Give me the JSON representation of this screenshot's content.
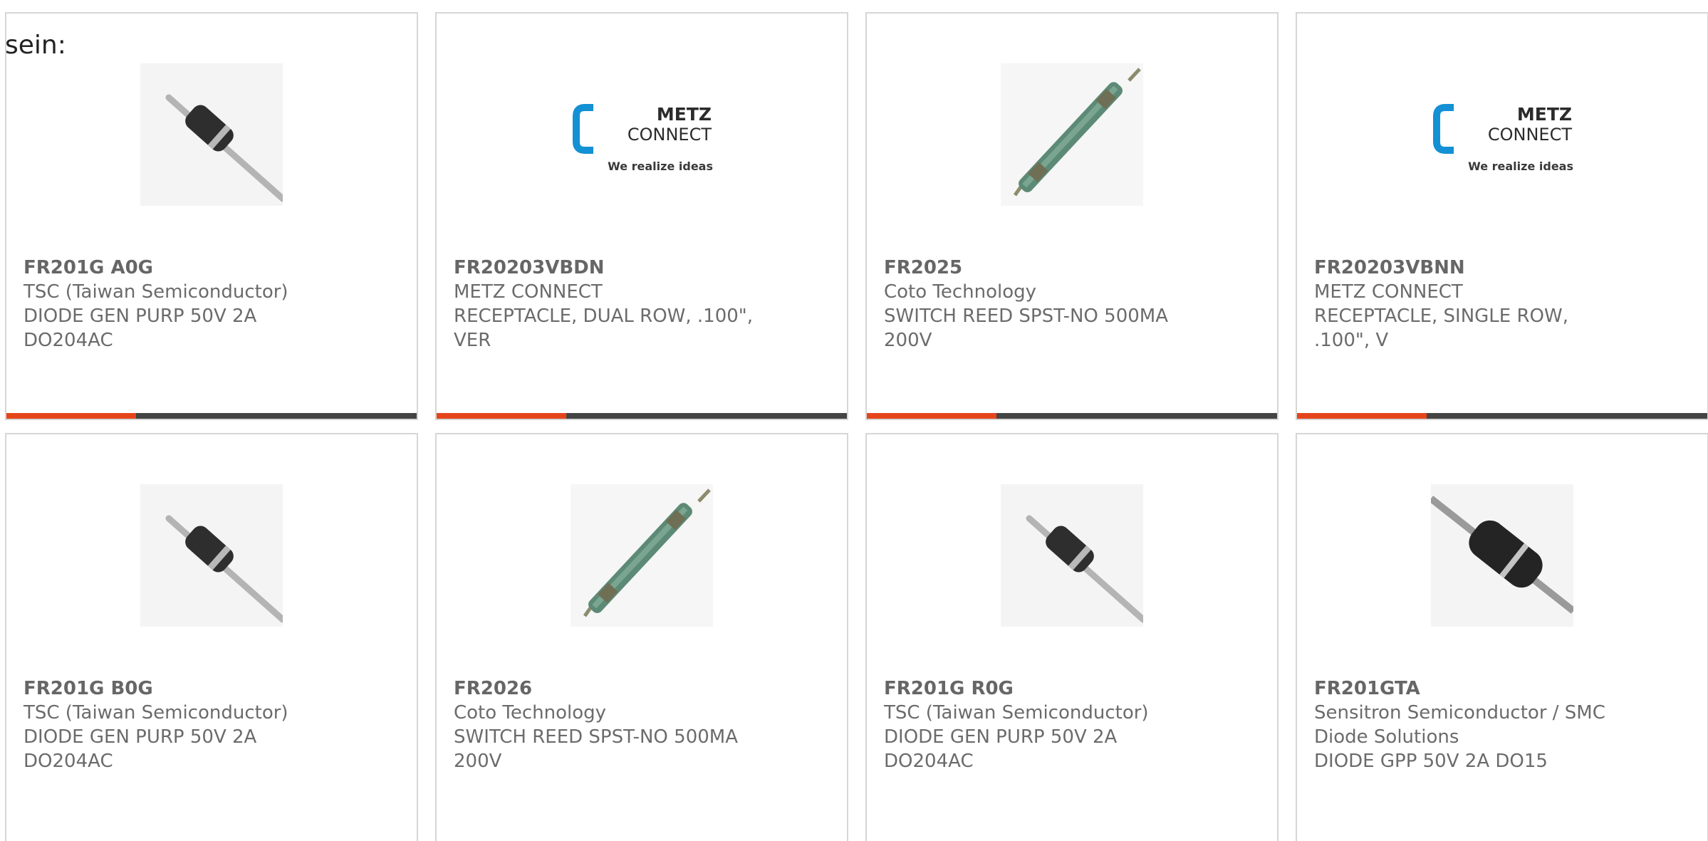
{
  "intro_text": "sein:",
  "accent_color": "#e5451b",
  "bar_color": "#444444",
  "products": [
    {
      "part_number": "FR201G A0G",
      "manufacturer": "TSC (Taiwan Semiconductor)",
      "description_line1": "DIODE GEN PURP 50V 2A",
      "description_line2": "DO204AC",
      "image": "axial-diode"
    },
    {
      "part_number": "FR20203VBDN",
      "manufacturer": "METZ CONNECT",
      "description_line1": "RECEPTACLE, DUAL ROW, .100\",",
      "description_line2": "VER",
      "image": "metz-connect-logo",
      "logo_word1": "METZ",
      "logo_word2": "CONNECT",
      "logo_tagline": "We realize ideas"
    },
    {
      "part_number": "FR2025",
      "manufacturer": "Coto Technology",
      "description_line1": "SWITCH REED SPST-NO 500MA",
      "description_line2": "200V",
      "image": "reed-switch"
    },
    {
      "part_number": "FR20203VBNN",
      "manufacturer": "METZ CONNECT",
      "description_line1": "RECEPTACLE, SINGLE ROW,",
      "description_line2": ".100\", V",
      "image": "metz-connect-logo",
      "logo_word1": "METZ",
      "logo_word2": "CONNECT",
      "logo_tagline": "We realize ideas"
    },
    {
      "part_number": "FR201G B0G",
      "manufacturer": "TSC (Taiwan Semiconductor)",
      "description_line1": "DIODE GEN PURP 50V 2A",
      "description_line2": "DO204AC",
      "image": "axial-diode"
    },
    {
      "part_number": "FR2026",
      "manufacturer": "Coto Technology",
      "description_line1": "SWITCH REED SPST-NO 500MA",
      "description_line2": "200V",
      "image": "reed-switch"
    },
    {
      "part_number": "FR201G R0G",
      "manufacturer": "TSC (Taiwan Semiconductor)",
      "description_line1": "DIODE GEN PURP 50V 2A",
      "description_line2": "DO204AC",
      "image": "axial-diode"
    },
    {
      "part_number": "FR201GTA",
      "manufacturer": "Sensitron Semiconductor / SMC",
      "manufacturer_line2": "Diode Solutions",
      "description_line1": "DIODE GPP 50V 2A DO15",
      "image": "axial-diode-large"
    }
  ]
}
